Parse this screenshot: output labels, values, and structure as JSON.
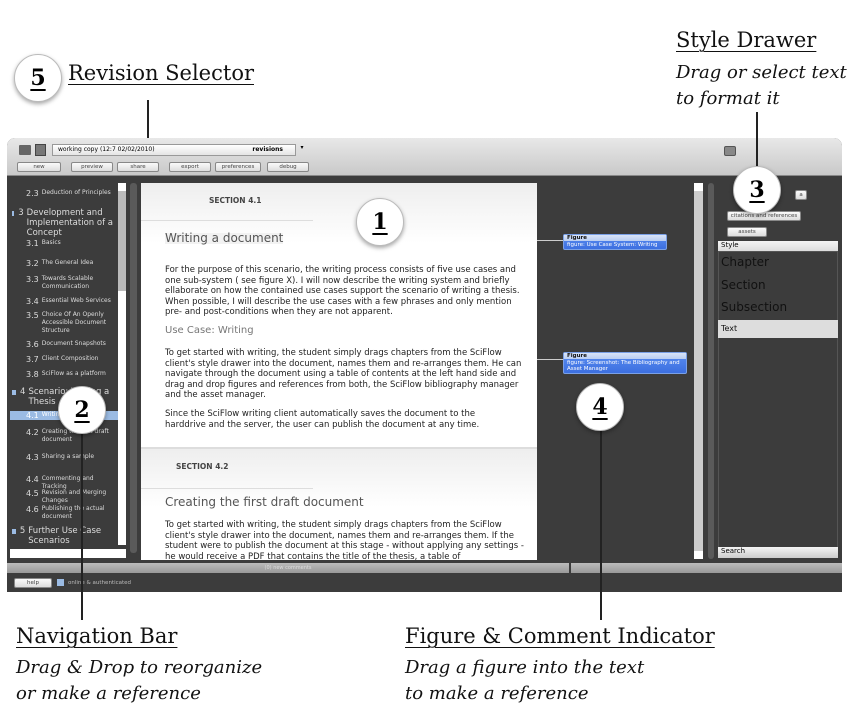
{
  "annotations": {
    "revision_selector": {
      "number": "5",
      "title": "Revision Selector"
    },
    "style_drawer": {
      "number": "3",
      "title": "Style Drawer",
      "desc": [
        "Drag or select text",
        "to format it"
      ]
    },
    "document": {
      "number": "1"
    },
    "navigation_bar": {
      "number": "2",
      "title": "Navigation Bar",
      "desc": [
        "Drag & Drop to reorganize",
        "or make a reference"
      ]
    },
    "figure_indicator": {
      "number": "4",
      "title": "Figure & Comment Indicator",
      "desc": [
        "Drag a figure into the text",
        "to make a reference"
      ]
    }
  },
  "toolbar": {
    "revision_value": "working copy (12:7 02/02/2010)",
    "revisions_label": "revisions",
    "buttons": [
      "new",
      "preview",
      "share",
      "export",
      "preferences",
      "debug"
    ]
  },
  "nav": {
    "items": [
      {
        "num": "2.3",
        "label": "Deduction of Principles"
      },
      {
        "num": "3",
        "label": "Development and Implementation of a Concept",
        "chapter": true
      },
      {
        "num": "3.1",
        "label": "Basics"
      },
      {
        "num": "3.2",
        "label": "The General Idea"
      },
      {
        "num": "3.3",
        "label": "Towards Scalable Communication"
      },
      {
        "num": "3.4",
        "label": "Essential Web Services"
      },
      {
        "num": "3.5",
        "label": "Choice Of An Openly Accessible Document Structure"
      },
      {
        "num": "3.6",
        "label": "Document Snapshots"
      },
      {
        "num": "3.7",
        "label": "Client Composition"
      },
      {
        "num": "3.8",
        "label": "SciFlow as a platform"
      },
      {
        "num": "4",
        "label": "Scenario: Writing a Thesis",
        "chapter": true
      },
      {
        "num": "4.1",
        "label": "Writing a document",
        "selected": true
      },
      {
        "num": "4.2",
        "label": "Creating the first draft document"
      },
      {
        "num": "4.3",
        "label": "Sharing a sample"
      },
      {
        "num": "4.4",
        "label": "Commenting and Tracking"
      },
      {
        "num": "4.5",
        "label": "Revision and Merging Changes"
      },
      {
        "num": "4.6",
        "label": "Publishing the actual document"
      },
      {
        "num": "5",
        "label": "Further Use Case Scenarios",
        "chapter": true
      }
    ]
  },
  "document": {
    "section1": {
      "label": "SECTION 4.1",
      "title": "Writing a document",
      "p1": "For the purpose of this scenario, the writing process consists of five use cases and one sub-system ( see figure X). I will now describe the writing system and briefly ellaborate on how the contained use cases support the scenario of writing a thesis. When possible, I will describe the use cases with a few phrases and only mention pre- and post-conditions when they are not apparent.",
      "subtitle": "Use Case: Writing",
      "p2": "To get started with writing, the student simply drags chapters from the SciFlow client's style drawer into the document, names them and re-arranges them. He can navigate through the document using a table of contents at the left hand side and drag and drop figures and references from both, the SciFlow bibliography manager and the asset manager.",
      "p3": "Since the SciFlow writing client automatically saves the document to the harddrive and the server, the user can publish the document at any time."
    },
    "section2": {
      "label": "SECTION 4.2",
      "title": "Creating the first draft document",
      "p1": "To get started with writing, the student simply drags chapters from the SciFlow client's style drawer into the document, names them and re-arranges them. If the student were to publish the document at this stage - without applying any settings - he would receive a PDF that contains the title of the thesis, a table of"
    }
  },
  "figures": [
    {
      "header": "Figure",
      "caption": "figure: Use Case System: Writing"
    },
    {
      "header": "Figure",
      "caption": "figure: Screenshot: The Bibliography and Asset Manager"
    }
  ],
  "drawer": {
    "small_button": "a",
    "citations": "citations and references",
    "assets": "assets",
    "style_header": "Style",
    "styles": [
      "Chapter",
      "Section",
      "Subsection",
      "Text"
    ],
    "search": "Search"
  },
  "status": {
    "comments": "(0) new comments",
    "help": "help",
    "online": "online & authenticated"
  }
}
